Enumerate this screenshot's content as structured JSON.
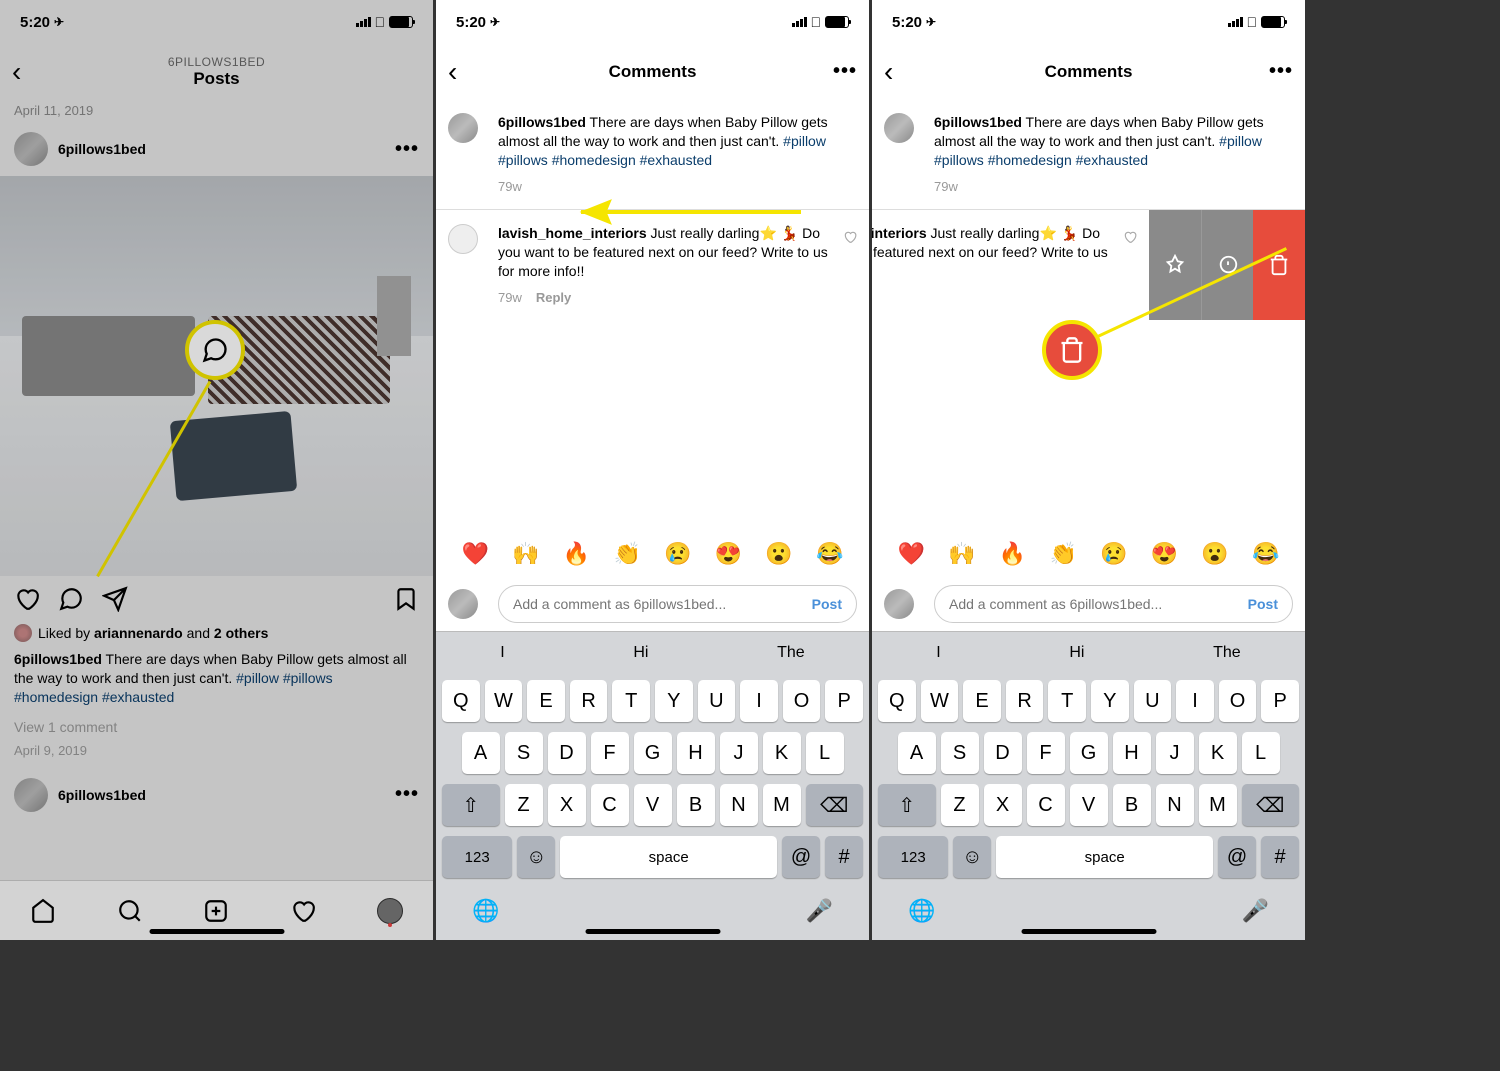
{
  "statusbar": {
    "time": "5:20",
    "signal": 4,
    "wifi": true,
    "battery": 85
  },
  "phone1": {
    "nav": {
      "subtitle": "6PILLOWS1BED",
      "title": "Posts"
    },
    "prev_date": "April 11, 2019",
    "post": {
      "username": "6pillows1bed",
      "liked_text_prefix": "Liked by ",
      "liker1": "ariannenardo",
      "liked_middle": " and ",
      "liker2": "2 others",
      "caption_user": "6pillows1bed",
      "caption_text": " There are days when Baby Pillow gets almost all the way to work and then just can't. ",
      "hashtags": "#pillow #pillows #homedesign #exhausted",
      "view_comments": "View 1 comment",
      "date": "April 9, 2019"
    },
    "next_username": "6pillows1bed"
  },
  "phone2": {
    "nav": {
      "title": "Comments"
    },
    "caption": {
      "username": "6pillows1bed",
      "text": " There are days when Baby Pillow gets almost all the way to work and then just can't. ",
      "hashtags": "#pillow #pillows #homedesign #exhausted",
      "age": "79w"
    },
    "comment": {
      "username": "lavish_home_interiors",
      "text": " Just really darling⭐ 💃 Do you want to be featured next on our feed? Write to us for more info!!",
      "age": "79w",
      "reply": "Reply"
    },
    "emojis": [
      "❤️",
      "🙌",
      "🔥",
      "👏",
      "😢",
      "😍",
      "😮",
      "😂"
    ],
    "input_placeholder": "Add a comment as 6pillows1bed...",
    "post_btn": "Post",
    "suggestions": [
      "I",
      "Hi",
      "The"
    ],
    "keyboard": {
      "row1": [
        "Q",
        "W",
        "E",
        "R",
        "T",
        "Y",
        "U",
        "I",
        "O",
        "P"
      ],
      "row2": [
        "A",
        "S",
        "D",
        "F",
        "G",
        "H",
        "J",
        "K",
        "L"
      ],
      "row3": [
        "Z",
        "X",
        "C",
        "V",
        "B",
        "N",
        "M"
      ],
      "num": "123",
      "space": "space",
      "at": "@",
      "hash": "#"
    }
  },
  "phone3": {
    "swipe_hint": "Swiped comment reveals pin, report and delete actions"
  }
}
